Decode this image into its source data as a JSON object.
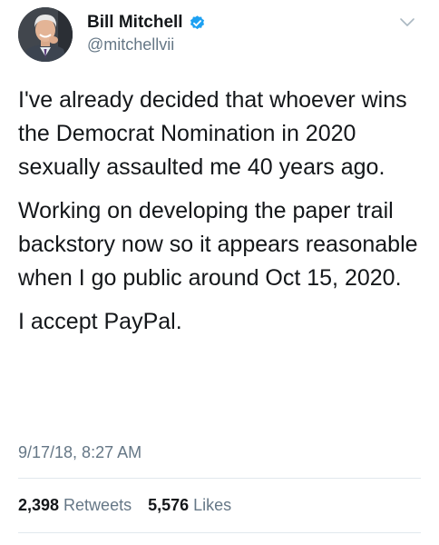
{
  "author": {
    "display_name": "Bill Mitchell",
    "handle": "@mitchellvii",
    "verified_icon": "verified-badge-icon"
  },
  "tweet": {
    "paragraphs": [
      "I've already decided that whoever wins the Democrat Nomination in 2020 sexually assaulted me 40 years ago.",
      "Working on developing the paper trail backstory now so it appears reasonable when I go public around Oct 15, 2020.",
      "I accept PayPal."
    ],
    "timestamp": "9/17/18, 8:27 AM"
  },
  "stats": {
    "retweets_count": "2,398",
    "retweets_label": "Retweets",
    "likes_count": "5,576",
    "likes_label": "Likes"
  },
  "colors": {
    "verified_blue": "#1da1f2",
    "secondary_text": "#657786",
    "divider": "#e1e8ed"
  }
}
